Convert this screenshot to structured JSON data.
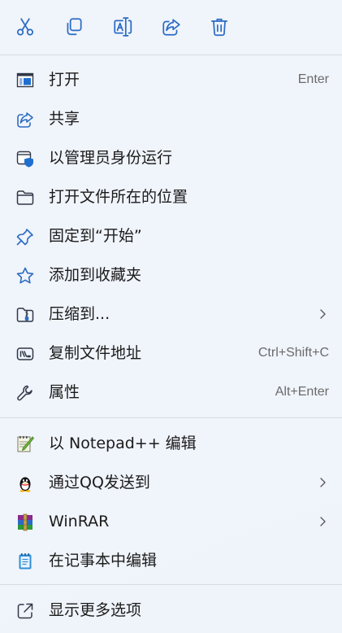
{
  "toolbar": {
    "buttons": [
      {
        "name": "cut",
        "icon": "scissors-icon"
      },
      {
        "name": "copy",
        "icon": "copy-icon"
      },
      {
        "name": "rename",
        "icon": "rename-icon"
      },
      {
        "name": "share",
        "icon": "share-icon"
      },
      {
        "name": "delete",
        "icon": "trash-icon"
      }
    ]
  },
  "menu": {
    "items": [
      {
        "label": "打开",
        "accel": "Enter",
        "icon": "app-window-icon"
      },
      {
        "label": "共享",
        "accel": "",
        "icon": "share-icon"
      },
      {
        "label": "以管理员身份运行",
        "accel": "",
        "icon": "admin-shield-icon"
      },
      {
        "label": "打开文件所在的位置",
        "accel": "",
        "icon": "folder-icon"
      },
      {
        "label": "固定到“开始”",
        "accel": "",
        "icon": "pin-icon"
      },
      {
        "label": "添加到收藏夹",
        "accel": "",
        "icon": "star-icon"
      },
      {
        "label": "压缩到...",
        "accel": "",
        "icon": "zip-folder-icon",
        "submenu": true
      },
      {
        "label": "复制文件地址",
        "accel": "Ctrl+Shift+C",
        "icon": "copy-path-icon"
      },
      {
        "label": "属性",
        "accel": "Alt+Enter",
        "icon": "wrench-icon"
      }
    ],
    "extra_items": [
      {
        "label": "以 Notepad++ 编辑",
        "icon": "notepadpp-icon"
      },
      {
        "label": "通过QQ发送到",
        "icon": "qq-penguin-icon",
        "submenu": true
      },
      {
        "label": "WinRAR",
        "icon": "winrar-icon",
        "submenu": true
      },
      {
        "label": "在记事本中编辑",
        "icon": "notepad-icon"
      }
    ],
    "more": {
      "label": "显示更多选项",
      "icon": "open-external-icon"
    }
  },
  "colors": {
    "accent": "#2b6cc4",
    "text": "#1b1b1b",
    "accel_text": "#6b6b6b",
    "divider": "#d6dbe4"
  }
}
